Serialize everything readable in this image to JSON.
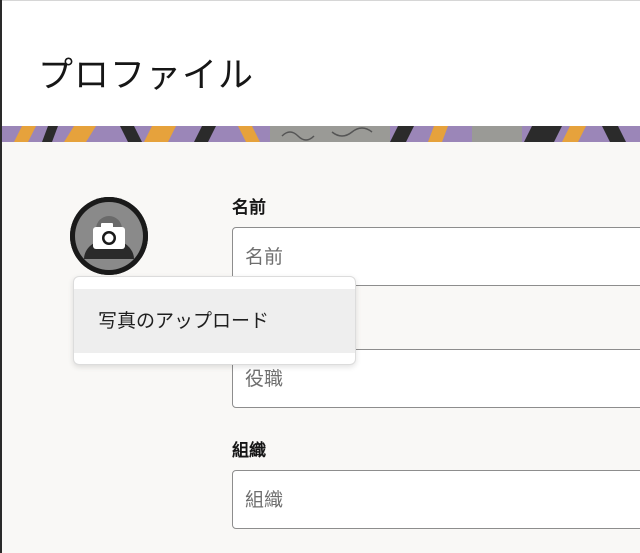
{
  "header": {
    "title": "プロファイル"
  },
  "avatar": {
    "icon": "camera-icon"
  },
  "popup_menu": {
    "items": [
      {
        "label": "写真のアップロード"
      }
    ]
  },
  "form": {
    "name": {
      "label": "名前",
      "placeholder": "名前"
    },
    "job_title": {
      "placeholder": "役職"
    },
    "organization": {
      "label": "組織",
      "placeholder": "組織"
    }
  },
  "colors": {
    "banner_purple": "#9b86b8",
    "banner_orange": "#e6a23c",
    "banner_gray": "#9a9a96",
    "content_bg": "#f9f8f6",
    "input_border": "#8d8d8d"
  }
}
